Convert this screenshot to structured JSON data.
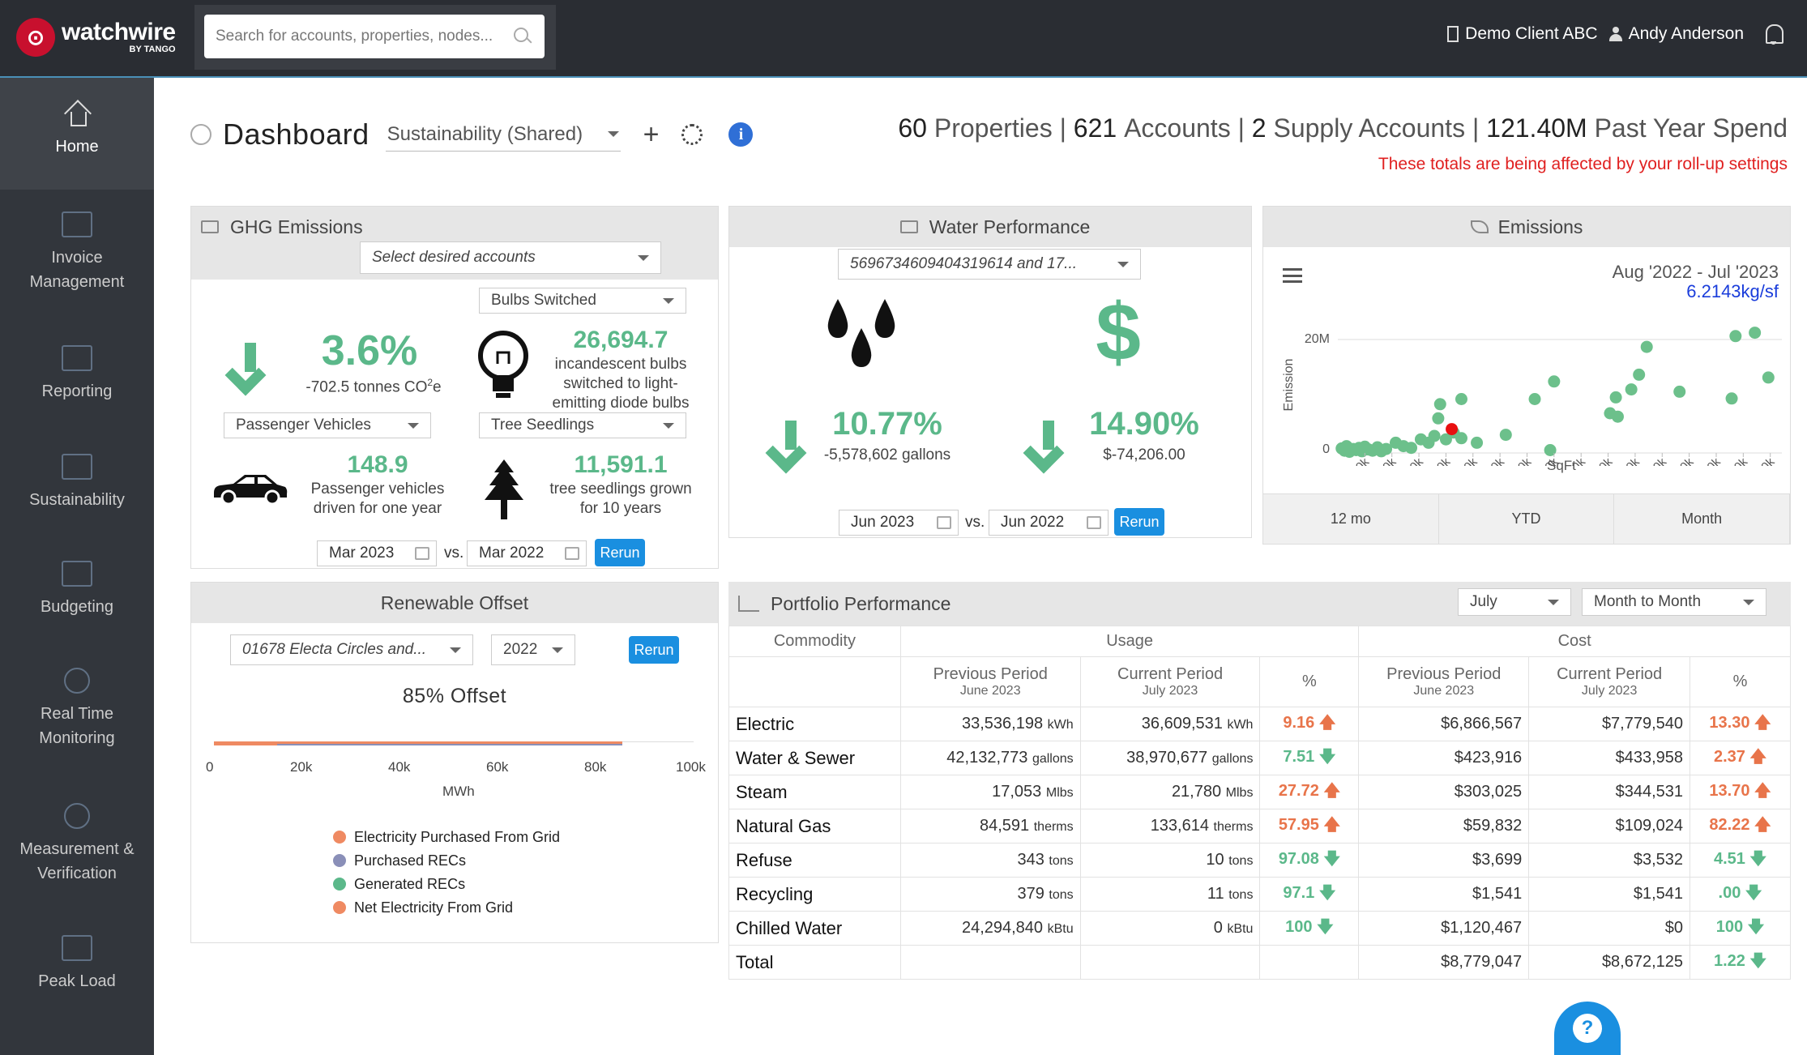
{
  "brand": {
    "name": "watchwire",
    "sub": "BY TANGO"
  },
  "search": {
    "placeholder": "Search for accounts, properties, nodes..."
  },
  "user": {
    "client": "Demo Client ABC",
    "name": "Andy Anderson"
  },
  "sidebar": {
    "items": [
      {
        "label": "Home"
      },
      {
        "label": "Invoice Management"
      },
      {
        "label": "Reporting"
      },
      {
        "label": "Sustainability"
      },
      {
        "label": "Budgeting"
      },
      {
        "label": "Real Time Monitoring"
      },
      {
        "label": "Measurement & Verification"
      },
      {
        "label": "Peak Load"
      }
    ]
  },
  "header": {
    "title": "Dashboard",
    "view": "Sustainability (Shared)",
    "plus": "+",
    "info": "i"
  },
  "totals": {
    "properties_n": "60",
    "properties_l": "Properties",
    "accounts_n": "621",
    "accounts_l": "Accounts",
    "supply_n": "2",
    "supply_l": "Supply Accounts",
    "spend_n": "121.40M",
    "spend_l": "Past Year Spend",
    "sep": "|",
    "note": "These totals are being affected by your roll-up settings"
  },
  "ghg": {
    "title": "GHG Emissions",
    "accounts_select": "Select desired accounts",
    "pct": "3.6%",
    "pct_sub_a": "-702.5 tonnes CO",
    "pct_sub_sup": "2",
    "pct_sub_b": "e",
    "bulbs_select": "Bulbs Switched",
    "bulbs_value": "26,694.7",
    "bulbs_text": "incandescent bulbs switched to light-emitting diode bulbs",
    "vehicles_select": "Passenger Vehicles",
    "vehicles_value": "148.9",
    "vehicles_text": "Passenger vehicles driven for one year",
    "trees_select": "Tree Seedlings",
    "trees_value": "11,591.1",
    "trees_text": "tree seedlings grown for 10 years",
    "date1": "Mar 2023",
    "vs": "vs.",
    "date2": "Mar 2022",
    "rerun": "Rerun"
  },
  "water": {
    "title": "Water Performance",
    "accounts_select": "5696734609404319614 and 17...",
    "dollar": "$",
    "pct1": "10.77%",
    "pct1_sub": "-5,578,602 gallons",
    "pct2": "14.90%",
    "pct2_sub": "$-74,206.00",
    "date1": "Jun 2023",
    "vs": "vs.",
    "date2": "Jun 2022",
    "rerun": "Rerun"
  },
  "emissions": {
    "title": "Emissions",
    "range": "Aug '2022 - Jul '2023",
    "intensity": "6.2143kg/sf",
    "tabs": [
      "12 mo",
      "YTD",
      "Month"
    ]
  },
  "chart_data": {
    "type": "scatter",
    "title": "",
    "xlabel": "SqFt",
    "ylabel": "Emission",
    "x_ticks": [
      "140k",
      "280k",
      "420k",
      "560k",
      "700k",
      "840k",
      "980k",
      "1120k",
      "1260k",
      "1400k",
      "1540k",
      "1680k",
      "1820k",
      "1960k",
      "2100k",
      "2240k"
    ],
    "y_ticks": [
      "0",
      "20M"
    ],
    "xlim": [
      0,
      2300000
    ],
    "ylim": [
      0,
      20000000
    ],
    "series": [
      {
        "color": "#6cc08b",
        "points": [
          [
            20000,
            800000
          ],
          [
            35000,
            400000
          ],
          [
            45000,
            1200000
          ],
          [
            60000,
            200000
          ],
          [
            80000,
            700000
          ],
          [
            95000,
            500000
          ],
          [
            110000,
            900000
          ],
          [
            125000,
            300000
          ],
          [
            140000,
            1100000
          ],
          [
            160000,
            600000
          ],
          [
            180000,
            400000
          ],
          [
            205000,
            1000000
          ],
          [
            225000,
            300000
          ],
          [
            250000,
            700000
          ],
          [
            300000,
            1800000
          ],
          [
            340000,
            1200000
          ],
          [
            380000,
            900000
          ],
          [
            430000,
            2400000
          ],
          [
            470000,
            1800000
          ],
          [
            500000,
            3000000
          ],
          [
            520000,
            6100000
          ],
          [
            530000,
            8600000
          ],
          [
            560000,
            2400000
          ],
          [
            600000,
            3600000
          ],
          [
            640000,
            2600000
          ],
          [
            640000,
            9500000
          ],
          [
            720000,
            1800000
          ],
          [
            870000,
            3200000
          ],
          [
            1020000,
            9500000
          ],
          [
            1100000,
            500000
          ],
          [
            1120000,
            12600000
          ],
          [
            1410000,
            7000000
          ],
          [
            1440000,
            9800000
          ],
          [
            1450000,
            6400000
          ],
          [
            1520000,
            11200000
          ],
          [
            1560000,
            13800000
          ],
          [
            1600000,
            18700000
          ],
          [
            1770000,
            10800000
          ],
          [
            2040000,
            9600000
          ],
          [
            2060000,
            20600000
          ],
          [
            2160000,
            21200000
          ],
          [
            2230000,
            13300000
          ]
        ]
      },
      {
        "color": "#e81010",
        "points": [
          [
            590000,
            4200000
          ]
        ]
      }
    ]
  },
  "renewable": {
    "title": "Renewable Offset",
    "account": "01678 Electa Circles and...",
    "year": "2022",
    "rerun": "Rerun",
    "offset": "85% Offset",
    "axis_ticks": [
      "0",
      "20k",
      "40k",
      "60k",
      "80k",
      "100k"
    ],
    "axis_label": "MWh",
    "legend": [
      {
        "label": "Electricity Purchased From Grid",
        "color": "#ef8a62"
      },
      {
        "label": "Purchased RECs",
        "color": "#8a8fb8"
      },
      {
        "label": "Generated RECs",
        "color": "#5bb88a"
      },
      {
        "label": "Net Electricity From Grid",
        "color": "#ef8a62"
      }
    ]
  },
  "portfolio": {
    "title": "Portfolio Performance",
    "month": "July",
    "compare": "Month to Month",
    "headers": {
      "commodity": "Commodity",
      "usage": "Usage",
      "cost": "Cost",
      "prev": "Previous Period",
      "curr": "Current Period",
      "pct": "%",
      "prev_date": "June 2023",
      "curr_date": "July 2023"
    },
    "rows": [
      {
        "name": "Electric",
        "u_prev": "33,536,198",
        "u_prev_unit": "kWh",
        "u_curr": "36,609,531",
        "u_curr_unit": "kWh",
        "u_pct": "9.16",
        "u_dir": "up",
        "c_prev": "$6,866,567",
        "c_curr": "$7,779,540",
        "c_pct": "13.30",
        "c_dir": "up"
      },
      {
        "name": "Water & Sewer",
        "u_prev": "42,132,773",
        "u_prev_unit": "gallons",
        "u_curr": "38,970,677",
        "u_curr_unit": "gallons",
        "u_pct": "7.51",
        "u_dir": "down",
        "c_prev": "$423,916",
        "c_curr": "$433,958",
        "c_pct": "2.37",
        "c_dir": "up"
      },
      {
        "name": "Steam",
        "u_prev": "17,053",
        "u_prev_unit": "Mlbs",
        "u_curr": "21,780",
        "u_curr_unit": "Mlbs",
        "u_pct": "27.72",
        "u_dir": "up",
        "c_prev": "$303,025",
        "c_curr": "$344,531",
        "c_pct": "13.70",
        "c_dir": "up"
      },
      {
        "name": "Natural Gas",
        "u_prev": "84,591",
        "u_prev_unit": "therms",
        "u_curr": "133,614",
        "u_curr_unit": "therms",
        "u_pct": "57.95",
        "u_dir": "up",
        "c_prev": "$59,832",
        "c_curr": "$109,024",
        "c_pct": "82.22",
        "c_dir": "up"
      },
      {
        "name": "Refuse",
        "u_prev": "343",
        "u_prev_unit": "tons",
        "u_curr": "10",
        "u_curr_unit": "tons",
        "u_pct": "97.08",
        "u_dir": "down",
        "c_prev": "$3,699",
        "c_curr": "$3,532",
        "c_pct": "4.51",
        "c_dir": "down"
      },
      {
        "name": "Recycling",
        "u_prev": "379",
        "u_prev_unit": "tons",
        "u_curr": "11",
        "u_curr_unit": "tons",
        "u_pct": "97.1",
        "u_dir": "down",
        "c_prev": "$1,541",
        "c_curr": "$1,541",
        "c_pct": ".00",
        "c_dir": "down"
      },
      {
        "name": "Chilled Water",
        "u_prev": "24,294,840",
        "u_prev_unit": "kBtu",
        "u_curr": "0",
        "u_curr_unit": "kBtu",
        "u_pct": "100",
        "u_dir": "down",
        "c_prev": "$1,120,467",
        "c_curr": "$0",
        "c_pct": "100",
        "c_dir": "down"
      },
      {
        "name": "Total",
        "u_prev": "",
        "u_prev_unit": "",
        "u_curr": "",
        "u_curr_unit": "",
        "u_pct": "",
        "u_dir": "",
        "c_prev": "$8,779,047",
        "c_curr": "$8,672,125",
        "c_pct": "1.22",
        "c_dir": "down"
      }
    ]
  },
  "help": {
    "label": "?"
  },
  "colors": {
    "green": "#5bb88a",
    "orange": "#e8744a",
    "blue": "#1a8fe0",
    "red": "#e02020"
  }
}
